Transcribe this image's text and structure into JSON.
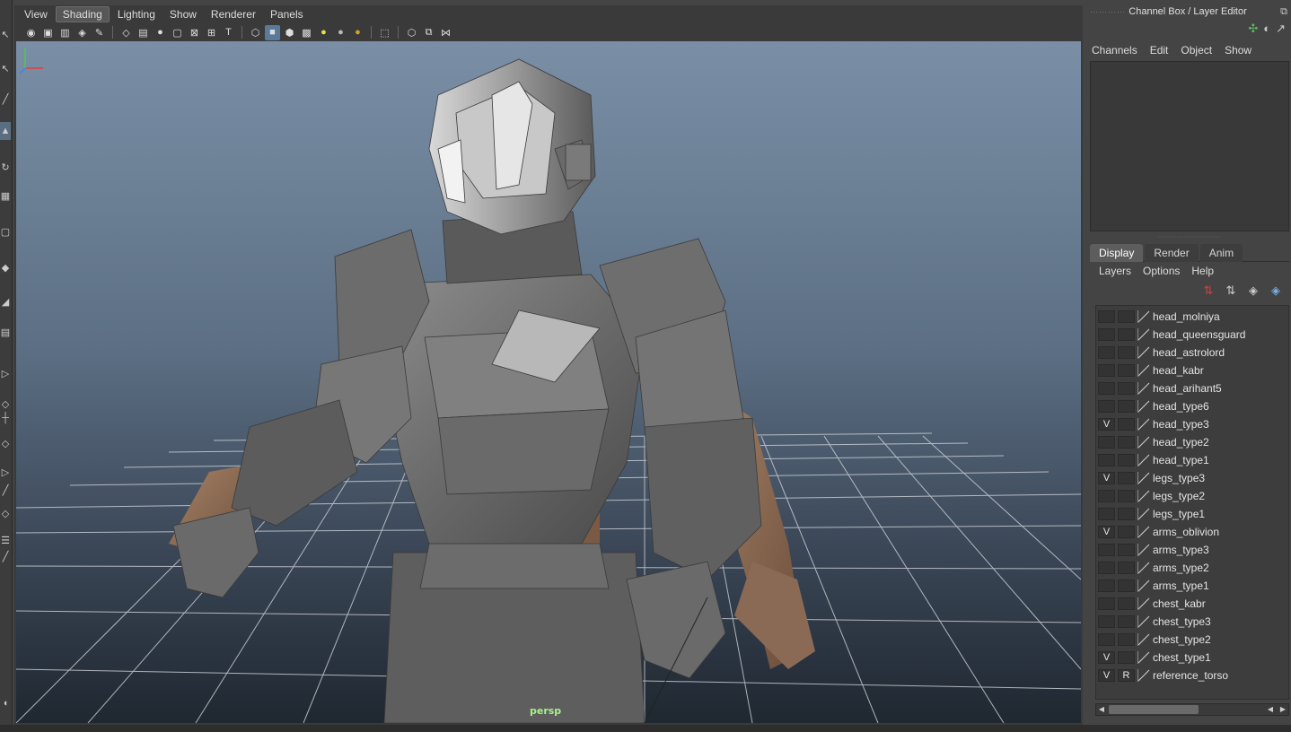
{
  "viewport": {
    "menus": [
      "View",
      "Shading",
      "Lighting",
      "Show",
      "Renderer",
      "Panels"
    ],
    "active_menu_index": 1,
    "camera_label": "persp"
  },
  "channel_box": {
    "title": "Channel Box / Layer Editor",
    "menus": [
      "Channels",
      "Edit",
      "Object",
      "Show"
    ]
  },
  "layer_editor": {
    "tabs": [
      "Display",
      "Render",
      "Anim"
    ],
    "active_tab_index": 0,
    "menus": [
      "Layers",
      "Options",
      "Help"
    ],
    "layers": [
      {
        "name": "head_molniya",
        "v": "",
        "r": ""
      },
      {
        "name": "head_queensguard",
        "v": "",
        "r": ""
      },
      {
        "name": "head_astrolord",
        "v": "",
        "r": ""
      },
      {
        "name": "head_kabr",
        "v": "",
        "r": ""
      },
      {
        "name": "head_arihant5",
        "v": "",
        "r": ""
      },
      {
        "name": "head_type6",
        "v": "",
        "r": ""
      },
      {
        "name": "head_type3",
        "v": "V",
        "r": ""
      },
      {
        "name": "head_type2",
        "v": "",
        "r": ""
      },
      {
        "name": "head_type1",
        "v": "",
        "r": ""
      },
      {
        "name": "legs_type3",
        "v": "V",
        "r": ""
      },
      {
        "name": "legs_type2",
        "v": "",
        "r": ""
      },
      {
        "name": "legs_type1",
        "v": "",
        "r": ""
      },
      {
        "name": "arms_oblivion",
        "v": "V",
        "r": ""
      },
      {
        "name": "arms_type3",
        "v": "",
        "r": ""
      },
      {
        "name": "arms_type2",
        "v": "",
        "r": ""
      },
      {
        "name": "arms_type1",
        "v": "",
        "r": ""
      },
      {
        "name": "chest_kabr",
        "v": "",
        "r": ""
      },
      {
        "name": "chest_type3",
        "v": "",
        "r": ""
      },
      {
        "name": "chest_type2",
        "v": "",
        "r": ""
      },
      {
        "name": "chest_type1",
        "v": "V",
        "r": ""
      },
      {
        "name": "reference_torso",
        "v": "V",
        "r": "R"
      }
    ]
  },
  "colors": {
    "accent": "#5a7a9a",
    "camera_label": "#a8f08a",
    "armor": "#6a6a6a",
    "skin": "#8a6a55"
  }
}
